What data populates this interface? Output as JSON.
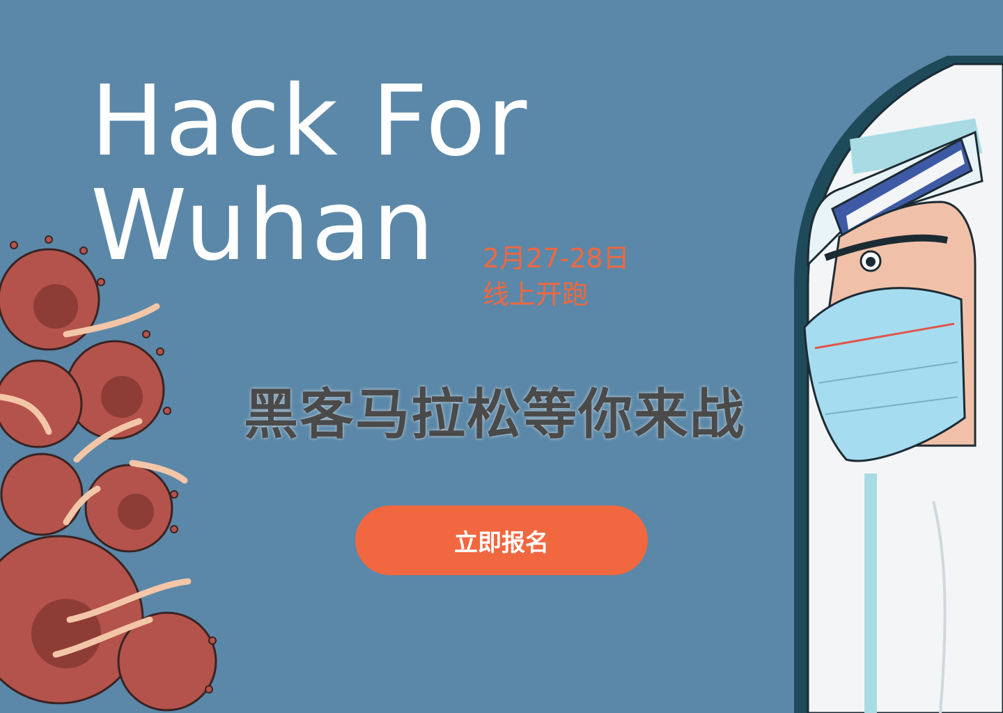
{
  "banner": {
    "title_line1": "Hack For",
    "title_line2": "Wuhan",
    "date_line1": "2月27-28日",
    "date_line2": "线上开跑",
    "slogan": "黑客马拉松等你来战",
    "cta_label": "立即报名"
  },
  "colors": {
    "background": "#5b88a8",
    "accent": "#f1673f",
    "title": "#ffffff",
    "slogan": "#4a4a4a"
  }
}
